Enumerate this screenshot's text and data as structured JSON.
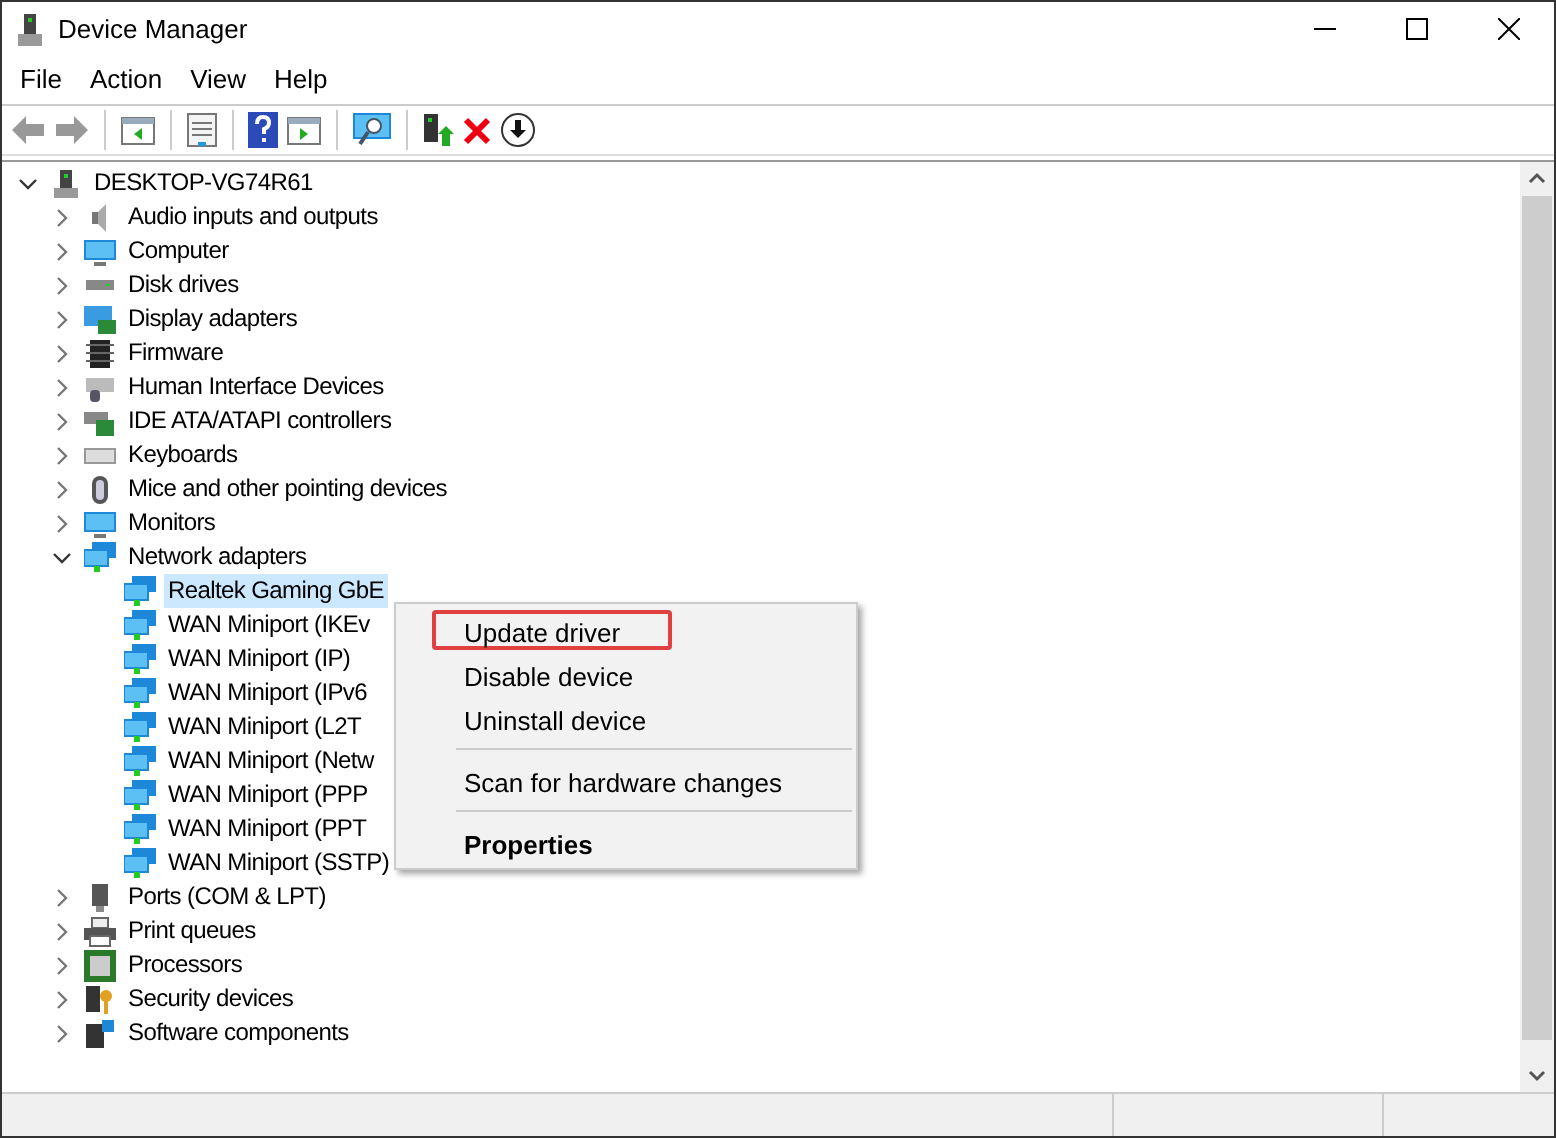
{
  "window": {
    "title": "Device Manager"
  },
  "menu": [
    "File",
    "Action",
    "View",
    "Help"
  ],
  "toolbar": [
    {
      "kind": "back",
      "disabled": true
    },
    {
      "kind": "forward",
      "disabled": true
    },
    {
      "kind": "sep"
    },
    {
      "kind": "tree"
    },
    {
      "kind": "sep"
    },
    {
      "kind": "props"
    },
    {
      "kind": "sep"
    },
    {
      "kind": "help"
    },
    {
      "kind": "pane"
    },
    {
      "kind": "sep"
    },
    {
      "kind": "scan"
    },
    {
      "kind": "sep"
    },
    {
      "kind": "update"
    },
    {
      "kind": "remove"
    },
    {
      "kind": "disable"
    }
  ],
  "tree": {
    "label": "DESKTOP-VG74R61",
    "kind": "computer",
    "expanded": true,
    "selected": false,
    "children": [
      {
        "label": "Audio inputs and outputs",
        "kind": "speaker",
        "expanded": false,
        "selected": false
      },
      {
        "label": "Computer",
        "kind": "monitor",
        "expanded": false,
        "selected": false
      },
      {
        "label": "Disk drives",
        "kind": "disk",
        "expanded": false,
        "selected": false
      },
      {
        "label": "Display adapters",
        "kind": "display",
        "expanded": false,
        "selected": false
      },
      {
        "label": "Firmware",
        "kind": "chip",
        "expanded": false,
        "selected": false
      },
      {
        "label": "Human Interface Devices",
        "kind": "hid",
        "expanded": false,
        "selected": false
      },
      {
        "label": "IDE ATA/ATAPI controllers",
        "kind": "card",
        "expanded": false,
        "selected": false
      },
      {
        "label": "Keyboards",
        "kind": "keyboard",
        "expanded": false,
        "selected": false
      },
      {
        "label": "Mice and other pointing devices",
        "kind": "mouse",
        "expanded": false,
        "selected": false
      },
      {
        "label": "Monitors",
        "kind": "monitor",
        "expanded": false,
        "selected": false
      },
      {
        "label": "Network adapters",
        "kind": "network",
        "expanded": true,
        "selected": false,
        "children": [
          {
            "label": "Realtek Gaming GbE",
            "kind": "network",
            "selected": true
          },
          {
            "label": "WAN Miniport (IKEv",
            "kind": "network",
            "selected": false
          },
          {
            "label": "WAN Miniport (IP)",
            "kind": "network",
            "selected": false
          },
          {
            "label": "WAN Miniport (IPv6",
            "kind": "network",
            "selected": false
          },
          {
            "label": "WAN Miniport (L2T",
            "kind": "network",
            "selected": false
          },
          {
            "label": "WAN Miniport (Netw",
            "kind": "network",
            "selected": false
          },
          {
            "label": "WAN Miniport (PPP",
            "kind": "network",
            "selected": false
          },
          {
            "label": "WAN Miniport (PPT",
            "kind": "network",
            "selected": false
          },
          {
            "label": "WAN Miniport (SSTP)",
            "kind": "network",
            "selected": false
          }
        ]
      },
      {
        "label": "Ports (COM & LPT)",
        "kind": "port",
        "expanded": false,
        "selected": false
      },
      {
        "label": "Print queues",
        "kind": "printer",
        "expanded": false,
        "selected": false
      },
      {
        "label": "Processors",
        "kind": "cpu",
        "expanded": false,
        "selected": false
      },
      {
        "label": "Security devices",
        "kind": "key",
        "expanded": false,
        "selected": false
      },
      {
        "label": "Software components",
        "kind": "software",
        "expanded": false,
        "selected": false
      }
    ]
  },
  "context_menu": [
    {
      "kind": "item",
      "label": "Update driver",
      "selected": true
    },
    {
      "kind": "item",
      "label": "Disable device",
      "selected": false
    },
    {
      "kind": "item",
      "label": "Uninstall device",
      "selected": false
    },
    {
      "kind": "separator"
    },
    {
      "kind": "item",
      "label": "Scan for hardware changes",
      "selected": false
    },
    {
      "kind": "separator"
    },
    {
      "kind": "default",
      "label": "Properties",
      "selected": false
    }
  ]
}
